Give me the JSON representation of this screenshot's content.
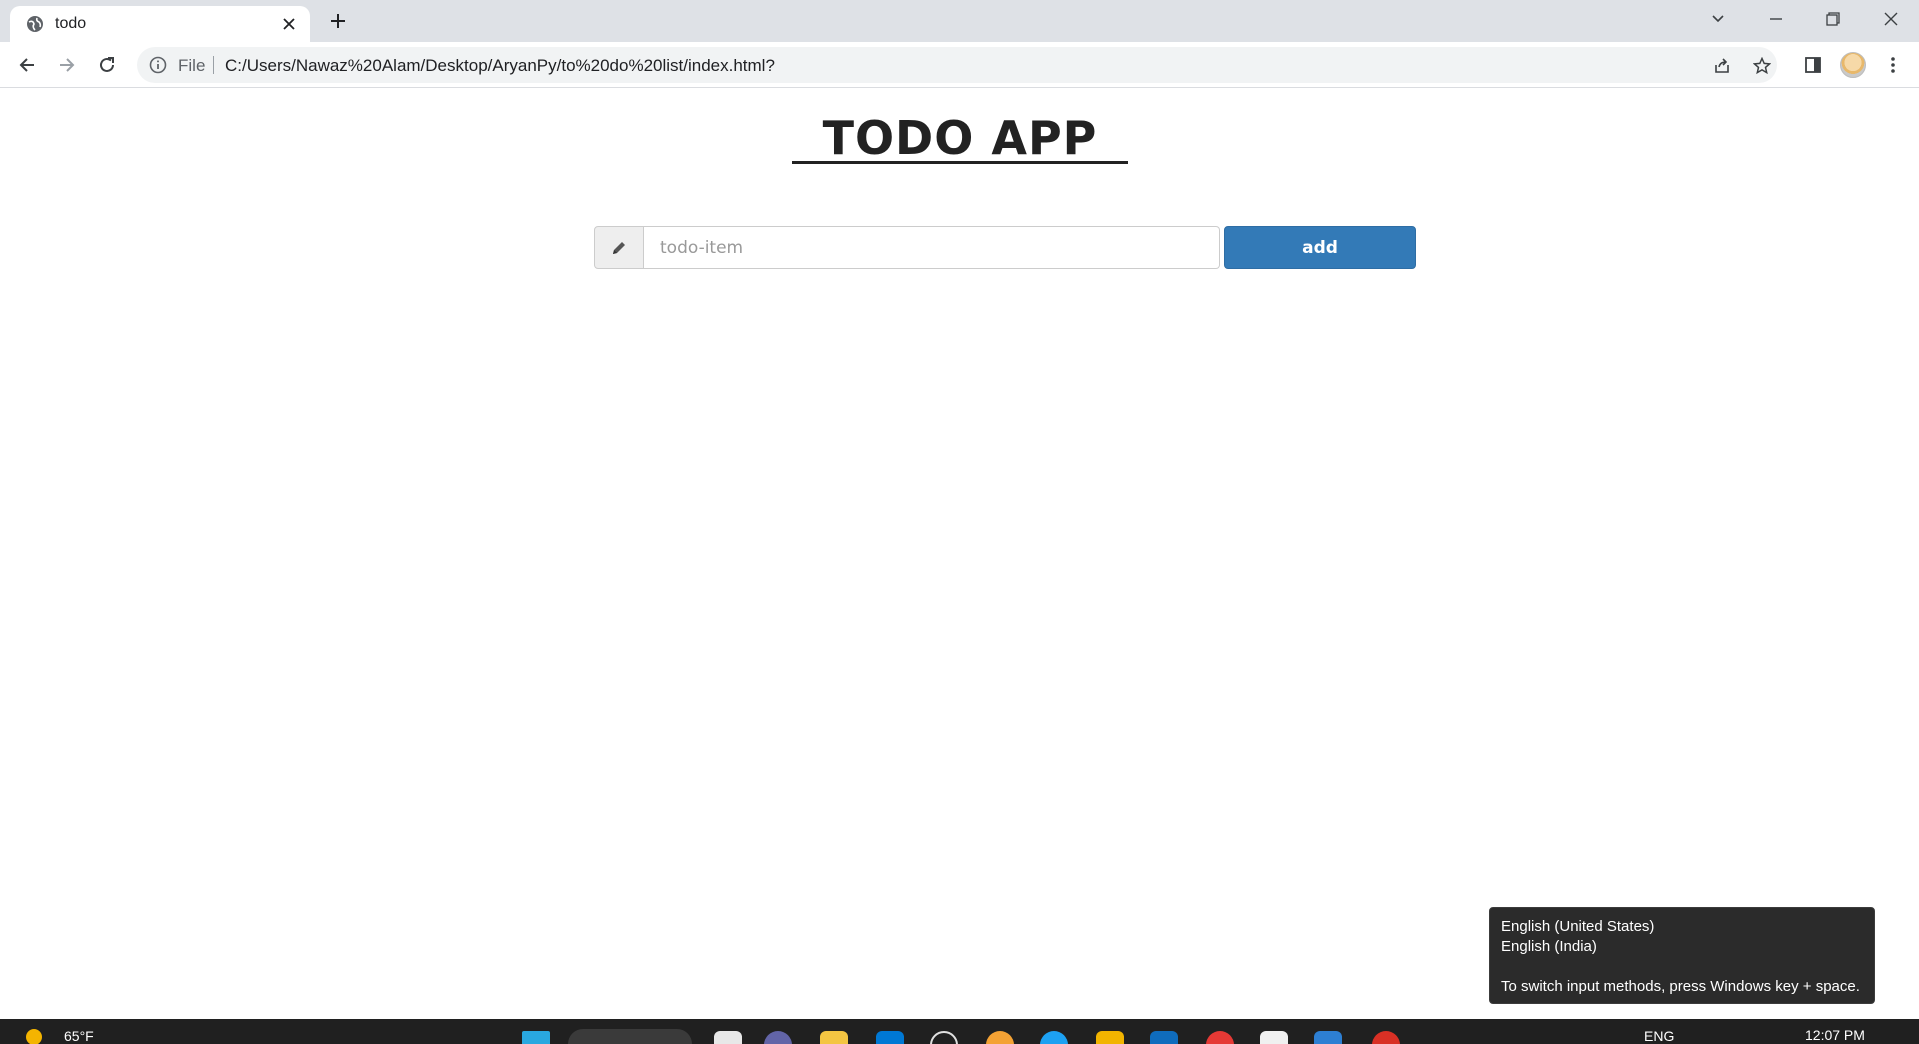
{
  "browser": {
    "tab_title": "todo",
    "address": {
      "scheme_label": "File",
      "url": "C:/Users/Nawaz%20Alam/Desktop/AryanPy/to%20do%20list/index.html?"
    }
  },
  "app": {
    "title": "TODO APP",
    "input": {
      "placeholder": "todo-item",
      "value": ""
    },
    "add_button_label": "add",
    "accent_color": "#337ab7"
  },
  "ime_tooltip": {
    "lines": [
      "English (United States)",
      "English (India)"
    ],
    "hint": "To switch input methods, press Windows key + space."
  },
  "taskbar": {
    "temperature": "65°F",
    "language": "ENG",
    "time": "12:07 PM"
  }
}
